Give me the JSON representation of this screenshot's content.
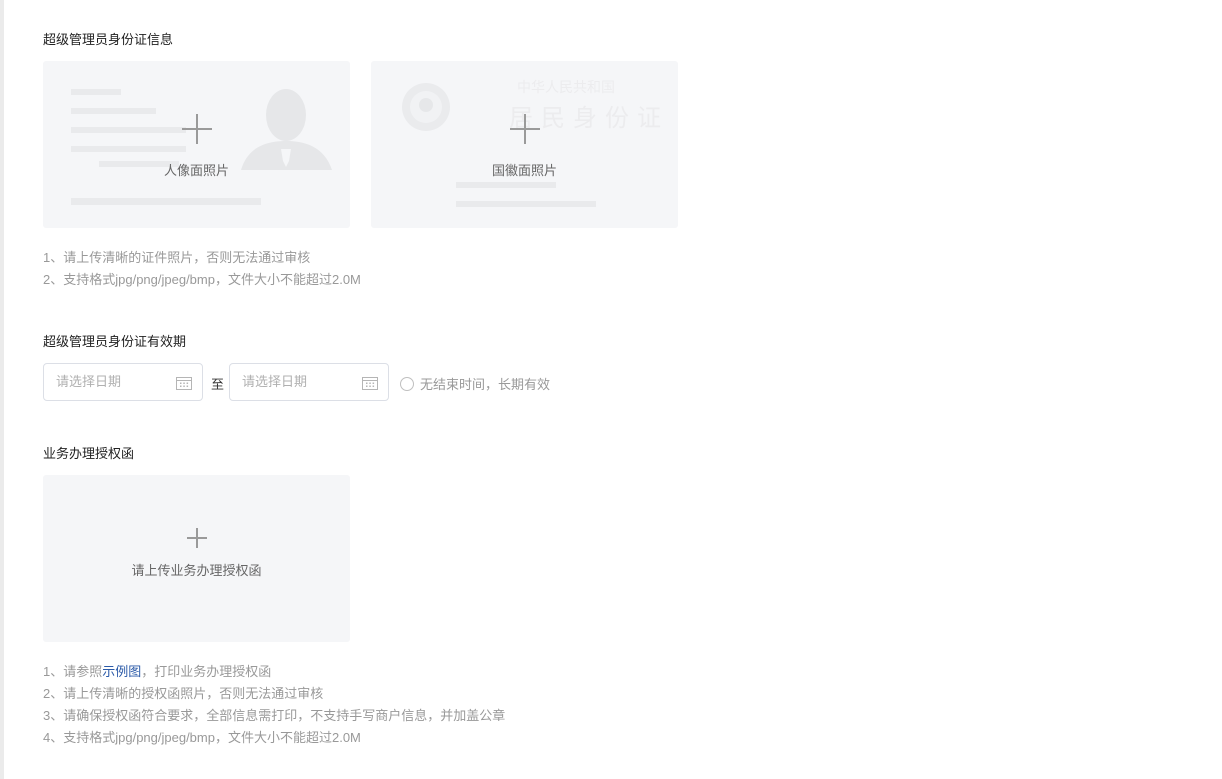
{
  "id_card": {
    "title": "超级管理员身份证信息",
    "front_label": "人像面照片",
    "back_label": "国徽面照片",
    "back_watermark_line1": "中华人民共和国",
    "back_watermark_line2": "居民身份证",
    "tips": [
      "1、请上传清晰的证件照片，否则无法通过审核",
      "2、支持格式jpg/png/jpeg/bmp，文件大小不能超过2.0M"
    ]
  },
  "validity": {
    "title": "超级管理员身份证有效期",
    "start_placeholder": "请选择日期",
    "end_placeholder": "请选择日期",
    "separator": "至",
    "no_end_label": "无结束时间，长期有效"
  },
  "authorization": {
    "title": "业务办理授权函",
    "upload_label": "请上传业务办理授权函",
    "tip1_prefix": "1、请参照",
    "tip1_link": "示例图",
    "tip1_suffix": "，打印业务办理授权函",
    "tips": [
      "2、请上传清晰的授权函照片，否则无法通过审核",
      "3、请确保授权函符合要求，全部信息需打印，不支持手写商户信息，并加盖公章",
      "4、支持格式jpg/png/jpeg/bmp，文件大小不能超过2.0M"
    ]
  },
  "colors": {
    "link": "#2b5aa8",
    "card_bg": "#f5f6f8",
    "tip_text": "#999999"
  }
}
